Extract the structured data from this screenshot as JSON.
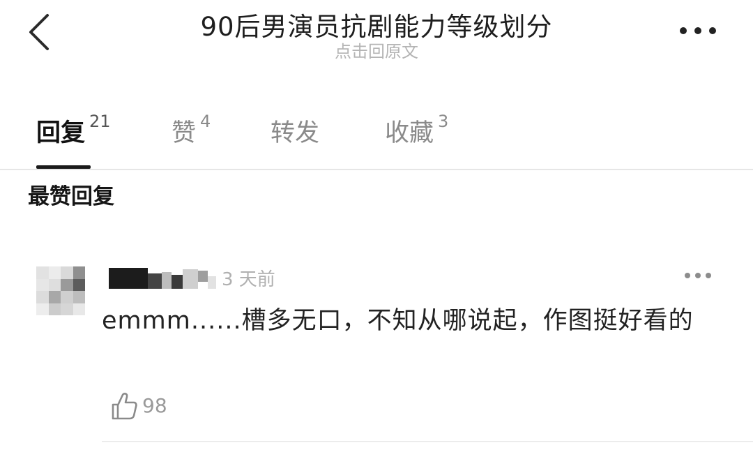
{
  "header": {
    "title": "90后男演员抗剧能力等级划分",
    "subtitle": "点击回原文"
  },
  "tabs": [
    {
      "label": "回复",
      "count": "21",
      "active": true
    },
    {
      "label": "赞",
      "count": "4",
      "active": false
    },
    {
      "label": "转发",
      "count": "",
      "active": false
    },
    {
      "label": "收藏",
      "count": "3",
      "active": false
    }
  ],
  "section_title": "最赞回复",
  "comment": {
    "timestamp": "3 天前",
    "text": "emmm......槽多无口，不知从哪说起，作图挺好看的",
    "like_count": "98"
  },
  "icons": {
    "back": "chevron-left-icon",
    "more": "more-horizontal-icon",
    "like": "thumbs-up-icon"
  }
}
